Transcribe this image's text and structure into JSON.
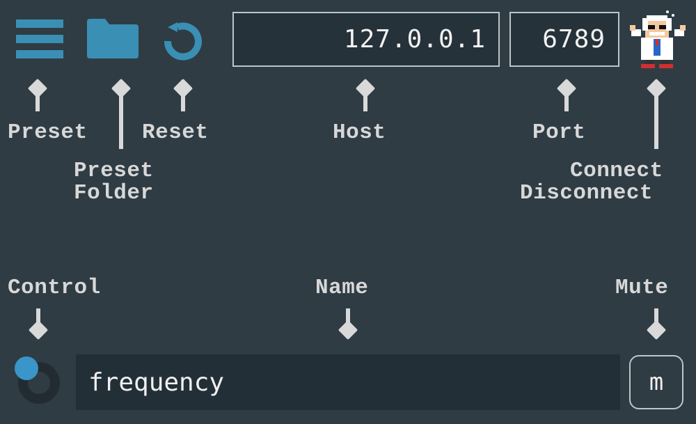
{
  "toolbar": {
    "host_value": "127.0.0.1",
    "port_value": "6789"
  },
  "labels": {
    "preset": "Preset",
    "preset_folder_line1": "Preset",
    "preset_folder_line2": "Folder",
    "reset": "Reset",
    "host": "Host",
    "port": "Port",
    "connect": "Connect",
    "disconnect": "Disconnect",
    "control": "Control",
    "name": "Name",
    "mute": "Mute"
  },
  "control_row": {
    "name_value": "frequency",
    "mute_label": "m"
  },
  "icons": {
    "preset": "hamburger-menu-icon",
    "preset_folder": "folder-icon",
    "reset": "reset-arrow-icon",
    "connect": "mascot-character-icon",
    "control": "knob-icon"
  },
  "colors": {
    "background": "#2f3c44",
    "accent": "#3a8fb5",
    "label": "#d8d8d8"
  }
}
